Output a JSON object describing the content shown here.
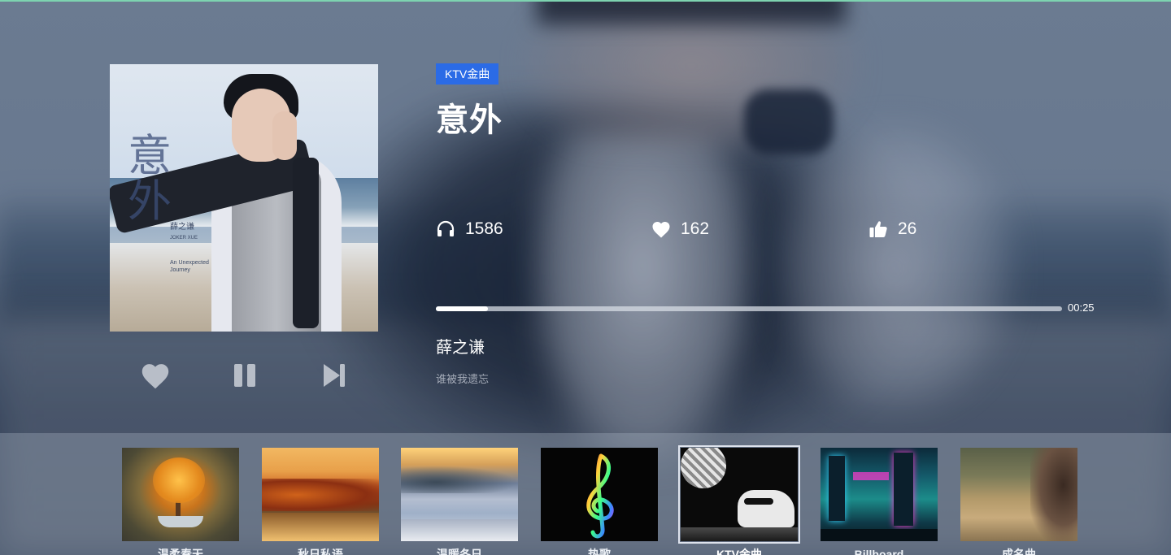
{
  "song": {
    "tag": "KTV金曲",
    "title": "意外",
    "artist": "薛之谦",
    "lyric": "谁被我遗忘"
  },
  "cover_art": {
    "callig": "意外",
    "artist_name": "薛之谦",
    "romanized": "JOKER XUE",
    "subtitle": "An Unexpected Journey"
  },
  "stats": {
    "plays": "1586",
    "likes": "162",
    "thumbs": "26"
  },
  "progress": {
    "elapsed": "00:25",
    "fraction": 0.083
  },
  "controls": {
    "like_icon": "heart-icon",
    "pause_icon": "pause-icon",
    "next_icon": "skip-next-icon"
  },
  "playlists": [
    {
      "label": "温柔春天",
      "active": false
    },
    {
      "label": "秋日私语",
      "active": false
    },
    {
      "label": "温暖冬日",
      "active": false
    },
    {
      "label": "热歌",
      "active": false
    },
    {
      "label": "KTV金曲",
      "active": true
    },
    {
      "label": "Billboard",
      "active": false
    },
    {
      "label": "成名曲",
      "active": false
    }
  ],
  "colors": {
    "accent": "#2b6be6",
    "top_line": "#7dd3b0"
  }
}
